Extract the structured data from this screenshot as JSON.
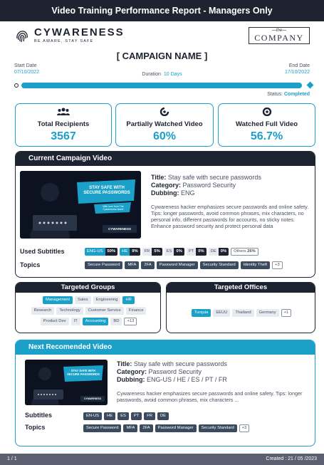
{
  "header": {
    "title": "Video Training Performance Report - Managers Only"
  },
  "brand": {
    "name": "CYWARENESS",
    "tagline": "BE AWARE, STAY SAFE",
    "client_logo_the": "—the—",
    "client_logo_name": "COMPANY"
  },
  "campaign": {
    "name": "[ CAMPAIGN NAME ]",
    "start_label": "Start Date",
    "start_date": "07/10/2022",
    "end_label": "End Date",
    "end_date": "17/10/2022",
    "duration_label": "Duration",
    "duration_value": "10 Days",
    "progress": 1.0,
    "status_label": "Status:",
    "status_value": "Completed"
  },
  "stats": [
    {
      "label": "Total Recipients",
      "value": "3567",
      "icon": "users-icon"
    },
    {
      "label": "Partially Watched Video",
      "value": "60%",
      "icon": "partial-eye-icon"
    },
    {
      "label": "Watched Full Video",
      "value": "56.7%",
      "icon": "eye-icon"
    }
  ],
  "current_video": {
    "header": "Current Campaign Video",
    "thumb_title": "STAY SAFE WITH SECURE PASSWORDS",
    "thumb_sub": "With love from The Cywareness team!",
    "thumb_brand": "CYWARENESS",
    "title_label": "Title:",
    "title": "Stay safe with secure passwords",
    "category_label": "Category:",
    "category": "Password Security",
    "dubbing_label": "Dubbing:",
    "dubbing": "ENG",
    "description": "Cywareness hacker emphasizes secure passwords and online safety. Tips: longer passwords, avoid common phrases, mix characters, no personal info, different passwords for accounts, no sticky notes. Enhance password security and protect personal data",
    "subtitles_label": "Used Subtitles",
    "subtitles": [
      {
        "lang": "ENG-US",
        "pct": "50%",
        "style": "cyan"
      },
      {
        "lang": "HE",
        "pct": "9%",
        "style": "cyan"
      },
      {
        "lang": "FR",
        "pct": "5%",
        "style": "grey"
      },
      {
        "lang": "ES",
        "pct": "0%",
        "style": "grey"
      },
      {
        "lang": "PT",
        "pct": "0%",
        "style": "grey"
      },
      {
        "lang": "DE",
        "pct": "0%",
        "style": "grey"
      },
      {
        "lang": "Others",
        "pct": "26%",
        "style": "outline"
      }
    ],
    "topics_label": "Topics",
    "topics": [
      "Secure Password",
      "MFA",
      "2FA",
      "Password Manager",
      "Security Standard",
      "Identity Theft"
    ],
    "topics_more": "+3"
  },
  "targeted_groups": {
    "header": "Targeted Groups",
    "rows": [
      [
        {
          "t": "Management",
          "s": "cyan"
        },
        {
          "t": "Sales",
          "s": "grey"
        },
        {
          "t": "Engineering",
          "s": "grey"
        },
        {
          "t": "HR",
          "s": "cyan"
        }
      ],
      [
        {
          "t": "Research",
          "s": "grey"
        },
        {
          "t": "Technology",
          "s": "grey"
        },
        {
          "t": "Customer Service",
          "s": "grey"
        },
        {
          "t": "Finance",
          "s": "grey"
        }
      ],
      [
        {
          "t": "Product Dev",
          "s": "grey"
        },
        {
          "t": "IT",
          "s": "grey"
        },
        {
          "t": "Accounting",
          "s": "cyan"
        },
        {
          "t": "BD",
          "s": "grey"
        },
        {
          "t": "+13",
          "s": "outline"
        }
      ]
    ]
  },
  "targeted_offices": {
    "header": "Targeted Offices",
    "items": [
      {
        "t": "Turquia",
        "s": "cyan"
      },
      {
        "t": "EEUU",
        "s": "grey"
      },
      {
        "t": "Thailand",
        "s": "grey"
      },
      {
        "t": "Germany",
        "s": "grey"
      },
      {
        "t": "+1",
        "s": "outline"
      }
    ]
  },
  "next_video": {
    "header": "Next Recomended Video",
    "thumb_title": "STAY SAFE WITH SECURE PASSWORDS",
    "thumb_brand": "CYWARENESS",
    "title_label": "Title:",
    "title": "Stay safe with secure passwords",
    "category_label": "Category:",
    "category": "Password Security",
    "dubbing_label": "Dubbing:",
    "dubbing": "ENG-US / HE / ES / PT / FR",
    "description": "Cywareness hacker emphasizes secure passwords and online safety. Tips: longer passwords, avoid common phrases, mix characters ...",
    "subtitles_label": "Subtitles",
    "subtitles": [
      "EN-US",
      "HE",
      "ES",
      "PT",
      "FR",
      "DE"
    ],
    "topics_label": "Topics",
    "topics": [
      "Secure Password",
      "MFA",
      "2FA",
      "Password Manager",
      "Security Standard"
    ],
    "topics_more": "+3"
  },
  "footer": {
    "page": "1 / 1",
    "created": "Created : 21 / 05 /2023"
  },
  "colors": {
    "accent": "#1aa0c9",
    "dark": "#1d2330",
    "chip_dark": "#3a4a5f"
  }
}
